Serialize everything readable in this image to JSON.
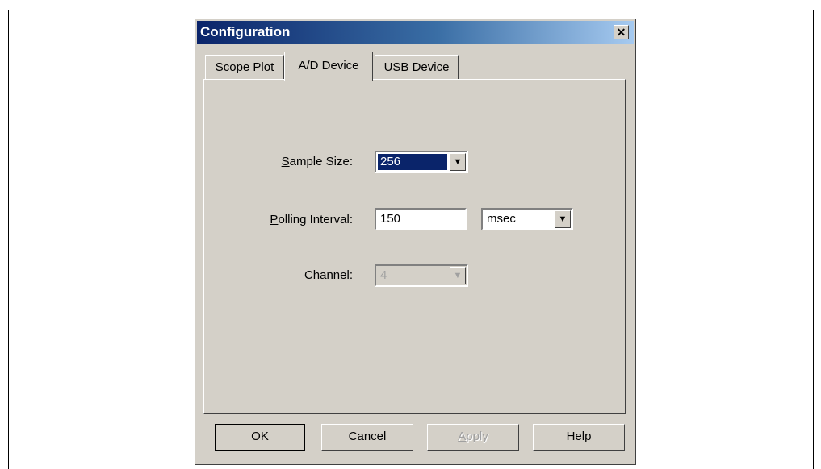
{
  "window": {
    "title": "Configuration",
    "close_glyph": "✕"
  },
  "tabs": [
    {
      "label": "Scope Plot",
      "active": false
    },
    {
      "label": "A/D Device",
      "active": true
    },
    {
      "label": "USB Device",
      "active": false
    }
  ],
  "form": {
    "sample_size": {
      "label_mnemonic": "S",
      "label_rest": "ample Size:",
      "value": "256",
      "selected": true
    },
    "polling_interval": {
      "label_mnemonic": "P",
      "label_rest": "olling Interval:",
      "value": "150",
      "unit": "msec"
    },
    "channel": {
      "label_mnemonic": "C",
      "label_rest": "hannel:",
      "value": "4",
      "disabled": true
    }
  },
  "buttons": {
    "ok": "OK",
    "cancel": "Cancel",
    "apply_mnemonic": "A",
    "apply_rest": "pply",
    "help": "Help"
  },
  "icons": {
    "dropdown": "chevron-down-icon",
    "close": "close-icon"
  }
}
